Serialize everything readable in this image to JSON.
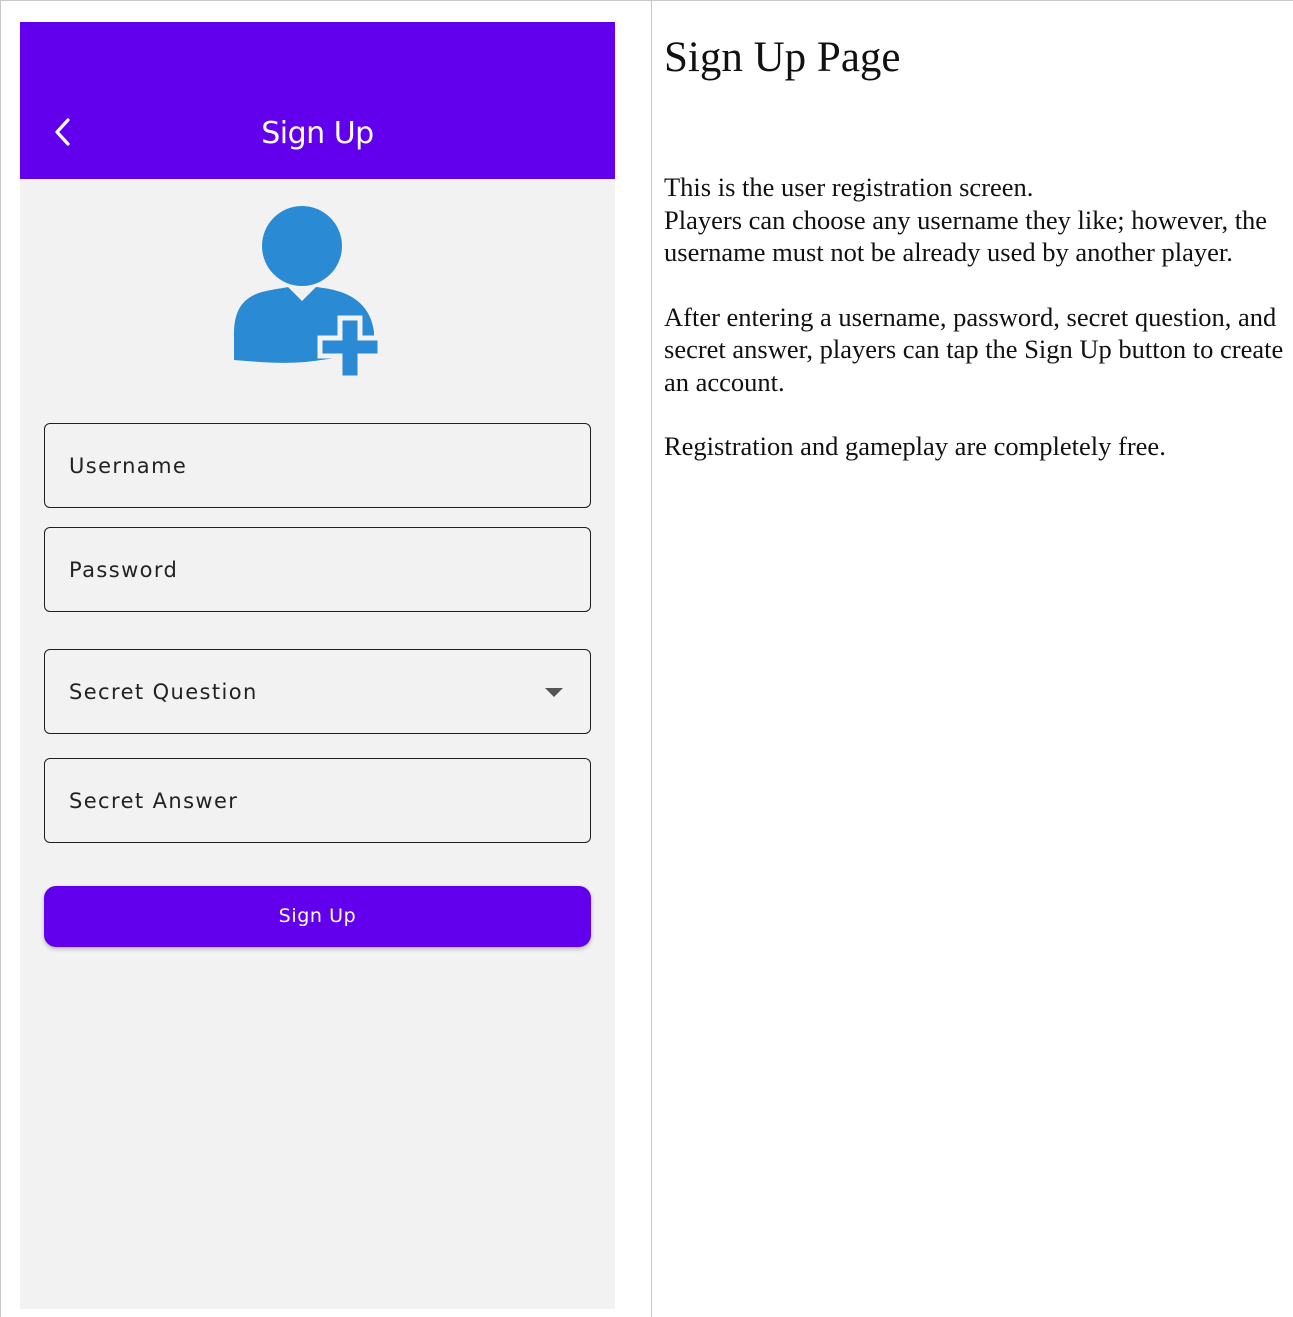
{
  "app_bar": {
    "title": "Sign Up",
    "back_icon": "chevron-left-icon",
    "color": "#6200ee"
  },
  "avatar": {
    "icon": "add-user-icon",
    "color": "#2a8bd4"
  },
  "form": {
    "username_label": "Username",
    "password_label": "Password",
    "secret_question_label": "Secret Question",
    "secret_answer_label": "Secret Answer",
    "dropdown_icon": "caret-down-icon",
    "submit_label": "Sign Up",
    "submit_color": "#6200ee"
  },
  "description": {
    "title": "Sign Up Page",
    "paragraphs": [
      "This is the user registration screen.\nPlayers can choose any username they like; however, the username must not be already used by another player.",
      "After entering a username, password, secret question, and secret answer, players can tap the Sign Up button to create an account.",
      "Registration and gameplay are completely free."
    ]
  }
}
